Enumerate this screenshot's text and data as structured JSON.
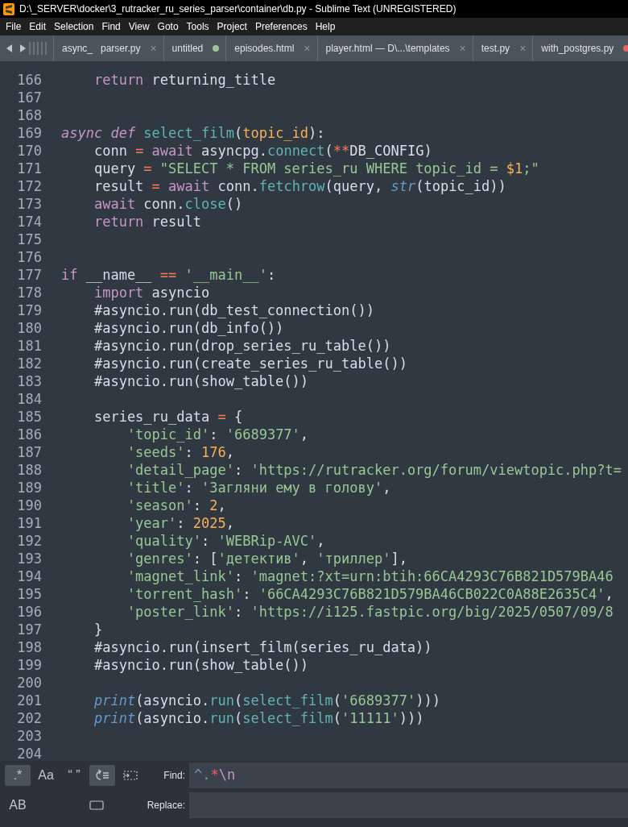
{
  "window": {
    "title": "D:\\_SERVER\\docker\\3_rutracker_ru_series_parser\\container\\db.py - Sublime Text (UNREGISTERED)"
  },
  "menu": [
    "File",
    "Edit",
    "Selection",
    "Find",
    "View",
    "Goto",
    "Tools",
    "Project",
    "Preferences",
    "Help"
  ],
  "tabs": [
    {
      "label": "async_   parser.py",
      "kind": "close",
      "symbol": "×"
    },
    {
      "label": "untitled",
      "kind": "dirty",
      "color": "#99c794"
    },
    {
      "label": "episodes.html",
      "kind": "close",
      "symbol": "×"
    },
    {
      "label": "player.html — D\\...\\templates",
      "kind": "close",
      "symbol": "×"
    },
    {
      "label": "test.py",
      "kind": "close",
      "symbol": "×"
    },
    {
      "label": "with_postgres.py",
      "kind": "dirty",
      "color": "#ec5f67"
    }
  ],
  "code_lines": [
    {
      "number": "166",
      "tokens": [
        {
          "kind": "kw",
          "text": "    return"
        },
        {
          "kind": "p",
          "text": " returning_title"
        }
      ]
    },
    {
      "number": "167"
    },
    {
      "number": "168"
    },
    {
      "number": "169",
      "tokens": [
        {
          "kind": "st",
          "text": "async def"
        },
        {
          "kind": "fn",
          "text": " select_film"
        },
        {
          "kind": "p",
          "text": "("
        },
        {
          "kind": "par",
          "text": "topic_id"
        },
        {
          "kind": "p",
          "text": "):"
        }
      ]
    },
    {
      "number": "170",
      "tokens": [
        {
          "kind": "p",
          "text": "    conn "
        },
        {
          "kind": "op",
          "text": "="
        },
        {
          "kind": "kw",
          "text": " await"
        },
        {
          "kind": "p",
          "text": " asyncpg."
        },
        {
          "kind": "fn",
          "text": "connect"
        },
        {
          "kind": "p",
          "text": "("
        },
        {
          "kind": "op",
          "text": "**"
        },
        {
          "kind": "p",
          "text": "DB_CONFIG)"
        }
      ]
    },
    {
      "number": "171",
      "tokens": [
        {
          "kind": "p",
          "text": "    query "
        },
        {
          "kind": "op",
          "text": "="
        },
        {
          "kind": "str",
          "text": " \"SELECT * FROM series_ru WHERE topic_id = "
        },
        {
          "kind": "num",
          "text": "$1"
        },
        {
          "kind": "str",
          "text": ";\""
        }
      ]
    },
    {
      "number": "172",
      "tokens": [
        {
          "kind": "p",
          "text": "    result "
        },
        {
          "kind": "op",
          "text": "="
        },
        {
          "kind": "kw",
          "text": " await"
        },
        {
          "kind": "p",
          "text": " conn."
        },
        {
          "kind": "fn",
          "text": "fetchrow"
        },
        {
          "kind": "p",
          "text": "(query, "
        },
        {
          "kind": "bi",
          "text": "str"
        },
        {
          "kind": "p",
          "text": "(topic_id))"
        }
      ]
    },
    {
      "number": "173",
      "tokens": [
        {
          "kind": "kw",
          "text": "    await"
        },
        {
          "kind": "p",
          "text": " conn."
        },
        {
          "kind": "fn",
          "text": "close"
        },
        {
          "kind": "p",
          "text": "()"
        }
      ]
    },
    {
      "number": "174",
      "tokens": [
        {
          "kind": "kw",
          "text": "    return"
        },
        {
          "kind": "p",
          "text": " result"
        }
      ]
    },
    {
      "number": "175"
    },
    {
      "number": "176"
    },
    {
      "number": "177",
      "tokens": [
        {
          "kind": "kw",
          "text": "if"
        },
        {
          "kind": "p",
          "text": " __name__ "
        },
        {
          "kind": "op",
          "text": "=="
        },
        {
          "kind": "str",
          "text": " '__main__'"
        },
        {
          "kind": "p",
          "text": ":"
        }
      ]
    },
    {
      "number": "178",
      "tokens": [
        {
          "kind": "kw",
          "text": "    import"
        },
        {
          "kind": "p",
          "text": " asyncio"
        }
      ]
    },
    {
      "number": "179",
      "tokens": [
        {
          "kind": "p",
          "text": "    #asyncio.run(db_test_connection())"
        }
      ]
    },
    {
      "number": "180",
      "tokens": [
        {
          "kind": "p",
          "text": "    #asyncio.run(db_info())"
        }
      ]
    },
    {
      "number": "181",
      "tokens": [
        {
          "kind": "p",
          "text": "    #asyncio.run(drop_series_ru_table())"
        }
      ]
    },
    {
      "number": "182",
      "tokens": [
        {
          "kind": "p",
          "text": "    #asyncio.run(create_series_ru_table())"
        }
      ]
    },
    {
      "number": "183",
      "tokens": [
        {
          "kind": "p",
          "text": "    #asyncio.run(show_table())"
        }
      ]
    },
    {
      "number": "184"
    },
    {
      "number": "185",
      "tokens": [
        {
          "kind": "p",
          "text": "    series_ru_data "
        },
        {
          "kind": "op",
          "text": "="
        },
        {
          "kind": "p",
          "text": " {"
        }
      ]
    },
    {
      "number": "186",
      "tokens": [
        {
          "kind": "str",
          "text": "        'topic_id'"
        },
        {
          "kind": "p",
          "text": ": "
        },
        {
          "kind": "str",
          "text": "'6689377'"
        },
        {
          "kind": "p",
          "text": ","
        }
      ]
    },
    {
      "number": "187",
      "tokens": [
        {
          "kind": "str",
          "text": "        'seeds'"
        },
        {
          "kind": "p",
          "text": ": "
        },
        {
          "kind": "num",
          "text": "176"
        },
        {
          "kind": "p",
          "text": ","
        }
      ]
    },
    {
      "number": "188",
      "tokens": [
        {
          "kind": "str",
          "text": "        'detail_page'"
        },
        {
          "kind": "p",
          "text": ": "
        },
        {
          "kind": "str",
          "text": "'https://rutracker.org/forum/viewtopic.php?t="
        }
      ]
    },
    {
      "number": "189",
      "tokens": [
        {
          "kind": "str",
          "text": "        'title'"
        },
        {
          "kind": "p",
          "text": ": "
        },
        {
          "kind": "str",
          "text": "'Загляни ему в голову'"
        },
        {
          "kind": "p",
          "text": ","
        }
      ]
    },
    {
      "number": "190",
      "tokens": [
        {
          "kind": "str",
          "text": "        'season'"
        },
        {
          "kind": "p",
          "text": ": "
        },
        {
          "kind": "num",
          "text": "2"
        },
        {
          "kind": "p",
          "text": ","
        }
      ]
    },
    {
      "number": "191",
      "tokens": [
        {
          "kind": "str",
          "text": "        'year'"
        },
        {
          "kind": "p",
          "text": ": "
        },
        {
          "kind": "num",
          "text": "2025"
        },
        {
          "kind": "p",
          "text": ","
        }
      ]
    },
    {
      "number": "192",
      "tokens": [
        {
          "kind": "str",
          "text": "        'quality'"
        },
        {
          "kind": "p",
          "text": ": "
        },
        {
          "kind": "str",
          "text": "'WEBRip-AVC'"
        },
        {
          "kind": "p",
          "text": ","
        }
      ]
    },
    {
      "number": "193",
      "tokens": [
        {
          "kind": "str",
          "text": "        'genres'"
        },
        {
          "kind": "p",
          "text": ": ["
        },
        {
          "kind": "str",
          "text": "'детектив'"
        },
        {
          "kind": "p",
          "text": ", "
        },
        {
          "kind": "str",
          "text": "'триллер'"
        },
        {
          "kind": "p",
          "text": "],"
        }
      ]
    },
    {
      "number": "194",
      "tokens": [
        {
          "kind": "str",
          "text": "        'magnet_link'"
        },
        {
          "kind": "p",
          "text": ": "
        },
        {
          "kind": "str",
          "text": "'magnet:?xt=urn:btih:66CA4293C76B821D579BA46"
        }
      ]
    },
    {
      "number": "195",
      "tokens": [
        {
          "kind": "str",
          "text": "        'torrent_hash'"
        },
        {
          "kind": "p",
          "text": ": "
        },
        {
          "kind": "str",
          "text": "'66CA4293C76B821D579BA46CB022C0A88E2635C4'"
        },
        {
          "kind": "p",
          "text": ","
        }
      ]
    },
    {
      "number": "196",
      "tokens": [
        {
          "kind": "str",
          "text": "        'poster_link'"
        },
        {
          "kind": "p",
          "text": ": "
        },
        {
          "kind": "str",
          "text": "'https://i125.fastpic.org/big/2025/0507/09/8"
        }
      ]
    },
    {
      "number": "197",
      "tokens": [
        {
          "kind": "p",
          "text": "    }"
        }
      ]
    },
    {
      "number": "198",
      "tokens": [
        {
          "kind": "p",
          "text": "    #asyncio.run(insert_film(series_ru_data))"
        }
      ]
    },
    {
      "number": "199",
      "tokens": [
        {
          "kind": "p",
          "text": "    #asyncio.run(show_table())"
        }
      ]
    },
    {
      "number": "200"
    },
    {
      "number": "201",
      "tokens": [
        {
          "kind": "bi",
          "text": "    print"
        },
        {
          "kind": "p",
          "text": "(asyncio."
        },
        {
          "kind": "fn",
          "text": "run"
        },
        {
          "kind": "p",
          "text": "("
        },
        {
          "kind": "fn",
          "text": "select_film"
        },
        {
          "kind": "p",
          "text": "("
        },
        {
          "kind": "str",
          "text": "'6689377'"
        },
        {
          "kind": "p",
          "text": ")))"
        }
      ]
    },
    {
      "number": "202",
      "tokens": [
        {
          "kind": "bi",
          "text": "    print"
        },
        {
          "kind": "p",
          "text": "(asyncio."
        },
        {
          "kind": "fn",
          "text": "run"
        },
        {
          "kind": "p",
          "text": "("
        },
        {
          "kind": "fn",
          "text": "select_film"
        },
        {
          "kind": "p",
          "text": "("
        },
        {
          "kind": "str",
          "text": "'11111'"
        },
        {
          "kind": "p",
          "text": ")))"
        }
      ]
    },
    {
      "number": "203"
    },
    {
      "number": "204"
    }
  ],
  "find_panel": {
    "options_row_1": [
      {
        "kind": "text",
        "label": ".*",
        "selected": true
      },
      {
        "kind": "text",
        "label": "Aa",
        "selected": false
      },
      {
        "kind": "text",
        "label": "“ ”",
        "selected": false
      },
      {
        "kind": "wrap",
        "selected": true
      },
      {
        "kind": "in_selection",
        "selected": false
      }
    ],
    "options_row_2": [
      {
        "kind": "text",
        "label": "AB",
        "selected": false
      },
      {
        "kind": "highlight",
        "selected": false
      }
    ],
    "find_label": "Find:",
    "find_tokens": [
      {
        "kind": "anchor",
        "text": "^"
      },
      {
        "kind": "anchor",
        "text": "."
      },
      {
        "kind": "quant",
        "text": "*"
      },
      {
        "kind": "esc",
        "text": "\\n"
      }
    ],
    "replace_label": "Replace:"
  }
}
